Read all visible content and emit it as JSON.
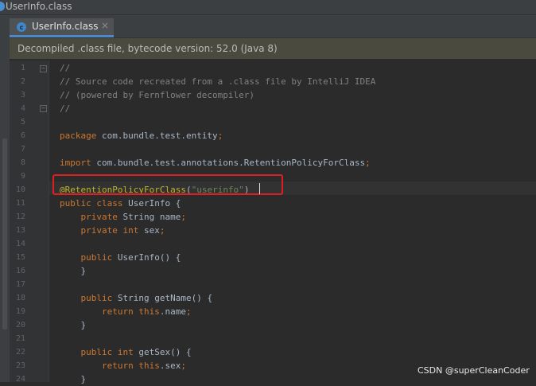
{
  "breadcrumb": {
    "file": "UserInfo.class"
  },
  "tab": {
    "label": "UserInfo.class",
    "close": "×"
  },
  "banner": {
    "text": "Decompiled .class file, bytecode version: 52.0 (Java 8)"
  },
  "code": {
    "line_numbers": [
      "1",
      "2",
      "3",
      "4",
      "5",
      "6",
      "7",
      "8",
      "9",
      "10",
      "11",
      "12",
      "13",
      "14",
      "15",
      "16",
      "17",
      "18",
      "19",
      "20",
      "21",
      "22",
      "23",
      "24"
    ],
    "lines": [
      {
        "ln": "1",
        "parts": [
          {
            "t": "//",
            "c": "cm"
          }
        ]
      },
      {
        "ln": "2",
        "parts": [
          {
            "t": "// Source code recreated from a .class file by IntelliJ IDEA",
            "c": "cm"
          }
        ]
      },
      {
        "ln": "3",
        "parts": [
          {
            "t": "// (powered by Fernflower decompiler)",
            "c": "cm"
          }
        ]
      },
      {
        "ln": "4",
        "parts": [
          {
            "t": "//",
            "c": "cm"
          }
        ]
      },
      {
        "ln": "5",
        "parts": []
      },
      {
        "ln": "6",
        "parts": [
          {
            "t": "package ",
            "c": "kw"
          },
          {
            "t": "com.bundle.test.entity",
            "c": "pl"
          },
          {
            "t": ";",
            "c": "kw"
          }
        ]
      },
      {
        "ln": "7",
        "parts": []
      },
      {
        "ln": "8",
        "parts": [
          {
            "t": "import ",
            "c": "kw"
          },
          {
            "t": "com.bundle.test.annotations.RetentionPolicyForClass",
            "c": "pl"
          },
          {
            "t": ";",
            "c": "kw"
          }
        ]
      },
      {
        "ln": "9",
        "parts": []
      },
      {
        "ln": "10",
        "parts": [
          {
            "t": "@RetentionPolicyForClass",
            "c": "an"
          },
          {
            "t": "(",
            "c": "pl"
          },
          {
            "t": "\"userinfo\"",
            "c": "st"
          },
          {
            "t": ")",
            "c": "pl"
          }
        ]
      },
      {
        "ln": "11",
        "parts": [
          {
            "t": "public class ",
            "c": "kw"
          },
          {
            "t": "UserInfo {",
            "c": "pl"
          }
        ]
      },
      {
        "ln": "12",
        "parts": [
          {
            "t": "    private ",
            "c": "kw"
          },
          {
            "t": "String name",
            "c": "pl"
          },
          {
            "t": ";",
            "c": "kw"
          }
        ]
      },
      {
        "ln": "13",
        "parts": [
          {
            "t": "    private int ",
            "c": "kw"
          },
          {
            "t": "sex",
            "c": "pl"
          },
          {
            "t": ";",
            "c": "kw"
          }
        ]
      },
      {
        "ln": "14",
        "parts": []
      },
      {
        "ln": "15",
        "parts": [
          {
            "t": "    public ",
            "c": "kw"
          },
          {
            "t": "UserInfo() {",
            "c": "pl"
          }
        ]
      },
      {
        "ln": "16",
        "parts": [
          {
            "t": "    }",
            "c": "pl"
          }
        ]
      },
      {
        "ln": "17",
        "parts": []
      },
      {
        "ln": "18",
        "parts": [
          {
            "t": "    public ",
            "c": "kw"
          },
          {
            "t": "String getName() {",
            "c": "pl"
          }
        ]
      },
      {
        "ln": "19",
        "parts": [
          {
            "t": "        return this",
            "c": "kw"
          },
          {
            "t": ".name",
            "c": "pl"
          },
          {
            "t": ";",
            "c": "kw"
          }
        ]
      },
      {
        "ln": "20",
        "parts": [
          {
            "t": "    }",
            "c": "pl"
          }
        ]
      },
      {
        "ln": "21",
        "parts": []
      },
      {
        "ln": "22",
        "parts": [
          {
            "t": "    public int ",
            "c": "kw"
          },
          {
            "t": "getSex() {",
            "c": "pl"
          }
        ]
      },
      {
        "ln": "23",
        "parts": [
          {
            "t": "        return this",
            "c": "kw"
          },
          {
            "t": ".sex",
            "c": "pl"
          },
          {
            "t": ";",
            "c": "kw"
          }
        ]
      },
      {
        "ln": "24",
        "parts": [
          {
            "t": "    }",
            "c": "pl"
          }
        ]
      }
    ]
  },
  "watermark": {
    "text": "CSDN @superCleanCoder"
  },
  "colors": {
    "keyword": "#cc7832",
    "comment": "#808080",
    "annotation": "#bbb529",
    "string": "#6a8759",
    "plain": "#a9b7c6",
    "highlight_box": "#e02020"
  },
  "icons": {
    "tab_icon": "class-file-icon",
    "fold": "fold-marker-icon"
  }
}
